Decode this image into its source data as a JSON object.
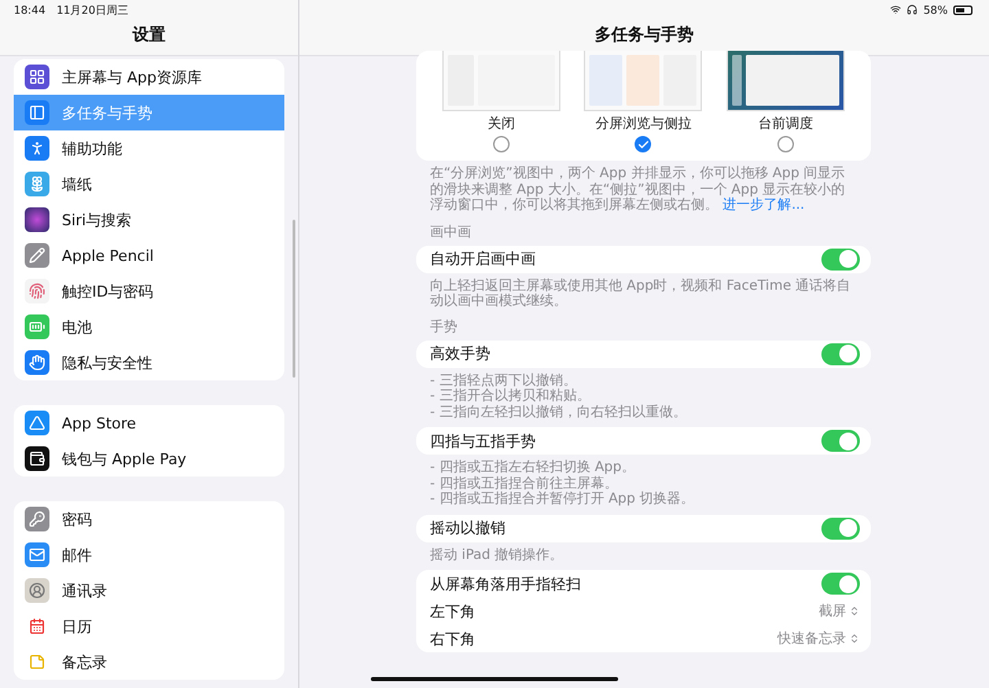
{
  "status_bar": {
    "time": "18:44",
    "date": "11月20日周三",
    "battery": "58%"
  },
  "sidebar": {
    "title": "设置",
    "groups": [
      [
        {
          "label": "主屏幕与 App资源库",
          "kind": "grid",
          "selected": false
        },
        {
          "label": "多任务与手势",
          "kind": "multitask",
          "selected": true
        },
        {
          "label": "辅助功能",
          "kind": "accessibility",
          "selected": false
        },
        {
          "label": "墙纸",
          "kind": "wallpaper",
          "selected": false
        },
        {
          "label": "Siri与搜索",
          "kind": "siri",
          "selected": false
        },
        {
          "label": "Apple Pencil",
          "kind": "pencil",
          "selected": false
        },
        {
          "label": "触控ID与密码",
          "kind": "fingerprint",
          "selected": false
        },
        {
          "label": "电池",
          "kind": "battery",
          "selected": false
        },
        {
          "label": "隐私与安全性",
          "kind": "hand",
          "selected": false
        }
      ],
      [
        {
          "label": "App Store",
          "kind": "appstore",
          "selected": false
        },
        {
          "label": "钱包与 Apple Pay",
          "kind": "wallet",
          "selected": false
        }
      ],
      [
        {
          "label": "密码",
          "kind": "key",
          "selected": false
        },
        {
          "label": "邮件",
          "kind": "mail",
          "selected": false
        },
        {
          "label": "通讯录",
          "kind": "contacts",
          "selected": false
        },
        {
          "label": "日历",
          "kind": "calendar",
          "selected": false
        },
        {
          "label": "备忘录",
          "kind": "notes",
          "selected": false
        }
      ]
    ]
  },
  "detail": {
    "title": "多任务与手势",
    "multitasking_options": [
      {
        "label": "关闭",
        "kind": "off",
        "selected": false
      },
      {
        "label": "分屏浏览与侧拉",
        "kind": "split",
        "selected": true
      },
      {
        "label": "台前调度",
        "kind": "stage",
        "selected": false
      }
    ],
    "multitasking_footer": {
      "text": "在“分屏浏览”视图中，两个 App 并排显示，你可以拖移 App 间显示的滑块来调整 App 大小。在“侧拉”视图中，一个 App 显示在较小的浮动窗口中，你可以将其拖到屏幕左侧或右侧。",
      "link": "进一步了解..."
    },
    "sections": [
      {
        "header": "画中画",
        "rows": [
          {
            "kind": "toggle",
            "label": "自动开启画中画",
            "on": true
          }
        ],
        "footer": [
          "向上轻扫返回主屏幕或使用其他 App时，视频和 FaceTime 通话将自动以画中画模式继续。"
        ]
      },
      {
        "header": "手势",
        "rows": [
          {
            "kind": "toggle",
            "label": "高效手势",
            "on": true
          }
        ],
        "footer": [
          "- 三指轻点两下以撤销。",
          "- 三指开合以拷贝和粘贴。",
          "- 三指向左轻扫以撤销，向右轻扫以重做。"
        ]
      },
      {
        "rows": [
          {
            "kind": "toggle",
            "label": "四指与五指手势",
            "on": true
          }
        ],
        "footer": [
          "- 四指或五指左右轻扫切换 App。",
          "- 四指或五指捏合前往主屏幕。",
          "- 四指或五指捏合并暂停打开 App 切换器。"
        ]
      },
      {
        "rows": [
          {
            "kind": "toggle",
            "label": "摇动以撤销",
            "on": true
          }
        ],
        "footer": [
          "摇动 iPad 撤销操作。"
        ]
      },
      {
        "rows": [
          {
            "kind": "toggle",
            "label": "从屏幕角落用手指轻扫",
            "on": true
          },
          {
            "kind": "select",
            "label": "左下角",
            "value": "截屏"
          },
          {
            "kind": "select",
            "label": "右下角",
            "value": "快速备忘录"
          }
        ]
      }
    ]
  }
}
